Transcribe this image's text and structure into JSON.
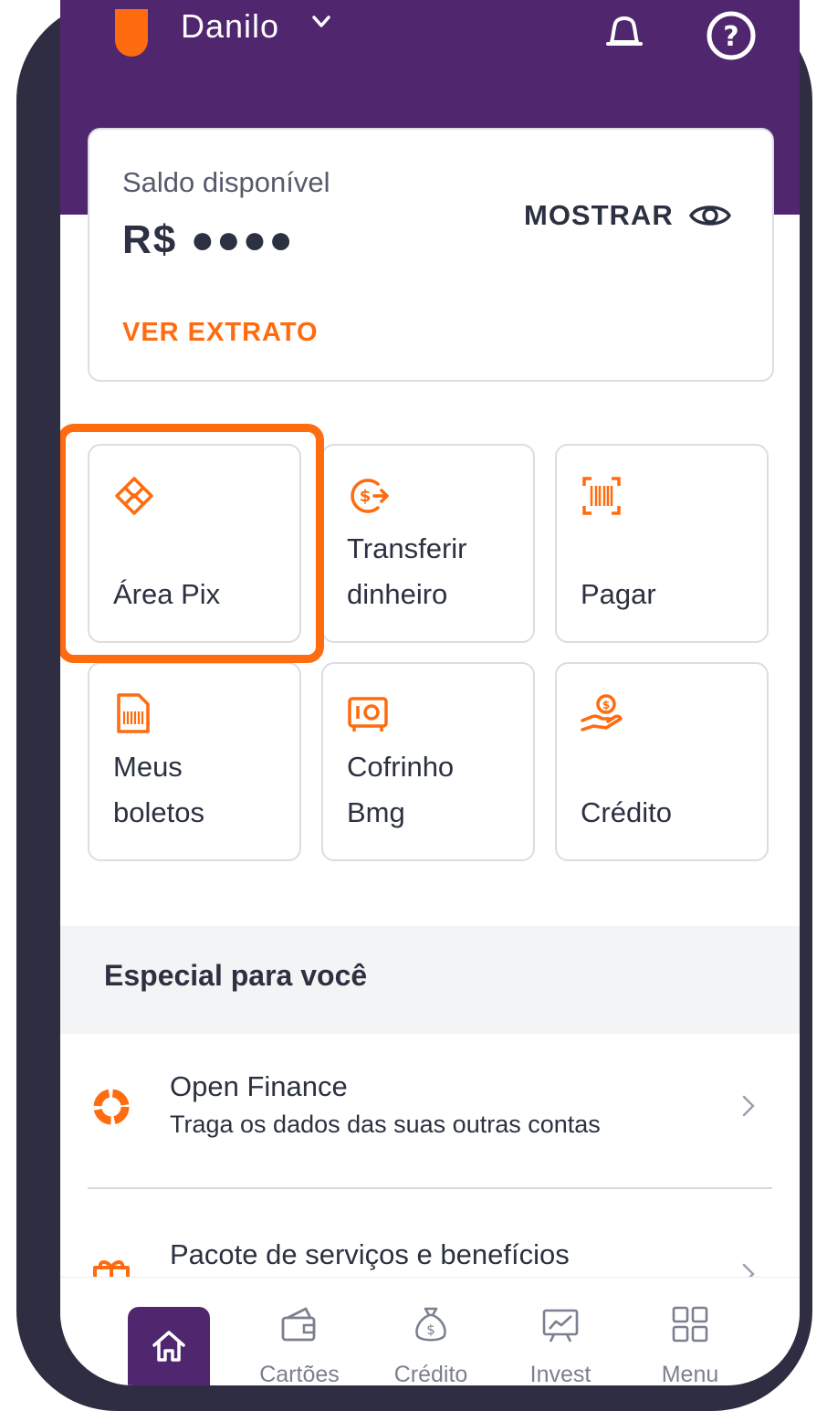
{
  "header": {
    "user_name": "Danilo"
  },
  "balance": {
    "label": "Saldo disponível",
    "value": "R$ ●●●●",
    "show_label": "MOSTRAR",
    "statement_label": "VER EXTRATO"
  },
  "tiles": [
    {
      "label_1": "Área Pix",
      "label_2": "",
      "icon": "pix-icon"
    },
    {
      "label_1": "Transferir",
      "label_2": "dinheiro",
      "icon": "transfer-money-icon"
    },
    {
      "label_1": "Pagar",
      "label_2": "",
      "icon": "barcode-scan-icon"
    },
    {
      "label_1": "Meus",
      "label_2": "boletos",
      "icon": "boleto-document-icon"
    },
    {
      "label_1": "Cofrinho",
      "label_2": "Bmg",
      "icon": "safe-icon"
    },
    {
      "label_1": "Crédito",
      "label_2": "",
      "icon": "hand-coin-icon"
    }
  ],
  "section": {
    "title": "Especial para você"
  },
  "list": [
    {
      "title": "Open Finance",
      "subtitle": "Traga os dados das suas outras contas",
      "icon": "open-finance-icon"
    },
    {
      "title": "Pacote de serviços e benefícios",
      "subtitle": "",
      "icon": "benefits-package-icon"
    }
  ],
  "nav": {
    "items": [
      {
        "label": "",
        "icon": "home-icon"
      },
      {
        "label": "Cartões",
        "icon": "wallet-card-icon"
      },
      {
        "label": "Crédito",
        "icon": "money-bag-icon"
      },
      {
        "label": "Invest",
        "icon": "chart-board-icon"
      },
      {
        "label": "Menu",
        "icon": "grid-icon"
      }
    ]
  },
  "colors": {
    "brand_purple": "#50266f",
    "accent_orange": "#ff6b0f",
    "frame": "#2f2d42",
    "text_dark": "#2b3140"
  }
}
